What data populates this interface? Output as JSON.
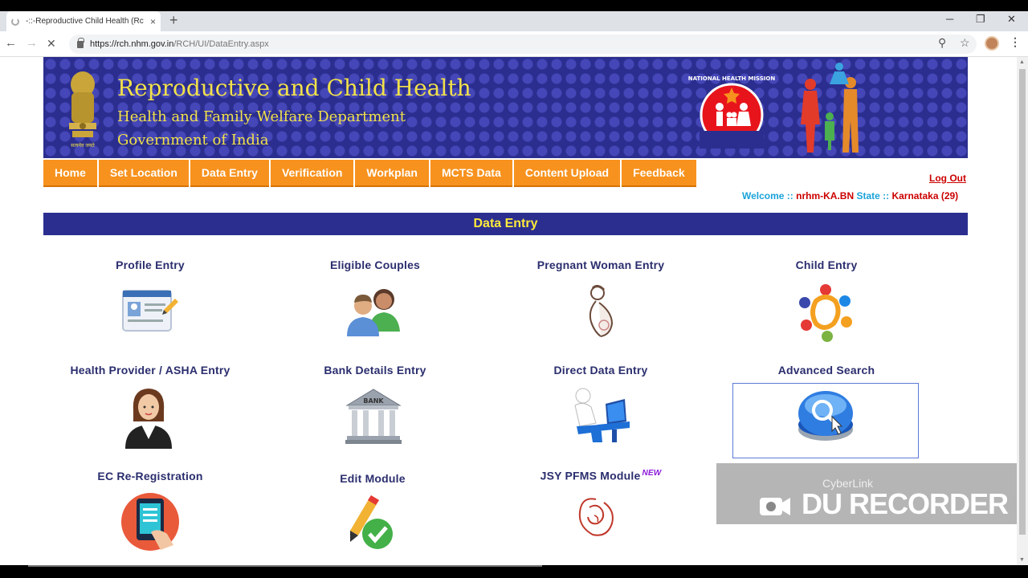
{
  "browser": {
    "tab_title": "-::-Reproductive Child Health (Rc",
    "tab_close": "×",
    "new_tab": "+",
    "url_host": "https://rch.nhm.gov.in",
    "url_path": "/RCH/UI/DataEntry.aspx"
  },
  "banner": {
    "title": "Reproductive and Child Health",
    "subtitle1": "Health and Family Welfare Department",
    "subtitle2": "Government of India",
    "emblem_motto": "सत्यमेव जयते",
    "nhm_text": "NATIONAL HEALTH MISSION"
  },
  "nav": {
    "items": [
      "Home",
      "Set Location",
      "Data Entry",
      "Verification",
      "Workplan",
      "MCTS Data",
      "Content Upload",
      "Feedback"
    ]
  },
  "user": {
    "logout": "Log Out",
    "welcome_label": "Welcome :: ",
    "username": "nrhm-KA.BN",
    "state_label": " State :: ",
    "state": "Karnataka (29)"
  },
  "section": {
    "title": "Data Entry"
  },
  "tiles": [
    {
      "label": "Profile Entry",
      "icon": "profile-card-icon"
    },
    {
      "label": "Eligible Couples",
      "icon": "couple-icon"
    },
    {
      "label": "Pregnant Woman Entry",
      "icon": "pregnant-woman-icon"
    },
    {
      "label": "Child Entry",
      "icon": "children-circle-icon"
    },
    {
      "label": "Health Provider / ASHA Entry",
      "icon": "health-worker-icon"
    },
    {
      "label": "Bank Details Entry",
      "icon": "bank-icon"
    },
    {
      "label": "Direct Data Entry",
      "icon": "computer-user-icon"
    },
    {
      "label": "Advanced Search",
      "icon": "search-button-icon"
    },
    {
      "label": "EC Re-Registration",
      "icon": "tablet-hand-icon"
    },
    {
      "label": "Edit Module",
      "icon": "pencil-check-icon"
    },
    {
      "label": "JSY PFMS Module",
      "icon": "mother-child-icon",
      "badge": "NEW"
    }
  ],
  "watermark": {
    "brand": "CyberLink",
    "product": "DU RECORDER"
  },
  "colors": {
    "banner": "#2b2e8f",
    "nav": "#f7921e",
    "heading": "#ffeb3b",
    "tile_text": "#2b2e6e"
  }
}
